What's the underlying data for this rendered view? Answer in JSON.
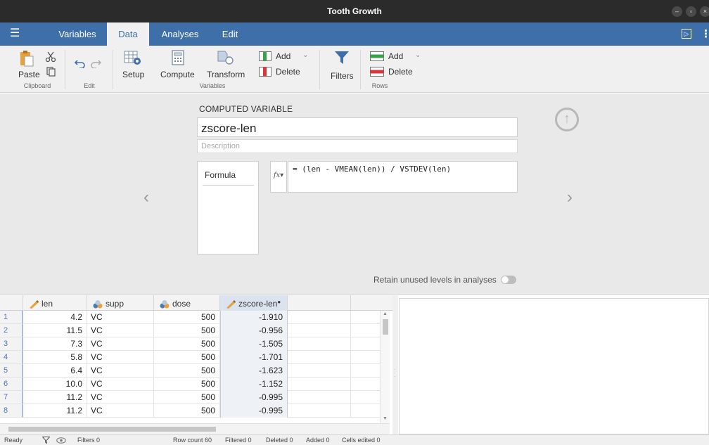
{
  "window": {
    "title": "Tooth Growth"
  },
  "menubar": {
    "tabs": [
      {
        "label": "Variables",
        "active": false
      },
      {
        "label": "Data",
        "active": true
      },
      {
        "label": "Analyses",
        "active": false
      },
      {
        "label": "Edit",
        "active": false
      }
    ]
  },
  "ribbon": {
    "clipboard": {
      "paste_label": "Paste",
      "group_label": "Clipboard"
    },
    "edit": {
      "group_label": "Edit"
    },
    "variables": {
      "setup_label": "Setup",
      "compute_label": "Compute",
      "transform_label": "Transform",
      "add_label": "Add",
      "delete_label": "Delete",
      "group_label": "Variables"
    },
    "filters_label": "Filters",
    "rows": {
      "add_label": "Add",
      "delete_label": "Delete",
      "group_label": "Rows"
    }
  },
  "computed": {
    "heading": "COMPUTED VARIABLE",
    "name": "zscore-len",
    "description_placeholder": "Description",
    "formula_tab": "Formula",
    "fx_label": "fx",
    "formula": "= (len - VMEAN(len)) / VSTDEV(len)",
    "retain_label": "Retain unused levels in analyses",
    "retain_on": false
  },
  "grid": {
    "columns": [
      {
        "name": "len",
        "type": "continuous"
      },
      {
        "name": "supp",
        "type": "nominal"
      },
      {
        "name": "dose",
        "type": "nominal"
      },
      {
        "name": "zscore-len",
        "type": "computed"
      }
    ],
    "rows": [
      {
        "num": "1",
        "len": "4.2",
        "supp": "VC",
        "dose": "500",
        "z": "-1.910"
      },
      {
        "num": "2",
        "len": "11.5",
        "supp": "VC",
        "dose": "500",
        "z": "-0.956"
      },
      {
        "num": "3",
        "len": "7.3",
        "supp": "VC",
        "dose": "500",
        "z": "-1.505"
      },
      {
        "num": "4",
        "len": "5.8",
        "supp": "VC",
        "dose": "500",
        "z": "-1.701"
      },
      {
        "num": "5",
        "len": "6.4",
        "supp": "VC",
        "dose": "500",
        "z": "-1.623"
      },
      {
        "num": "6",
        "len": "10.0",
        "supp": "VC",
        "dose": "500",
        "z": "-1.152"
      },
      {
        "num": "7",
        "len": "11.2",
        "supp": "VC",
        "dose": "500",
        "z": "-0.995"
      },
      {
        "num": "8",
        "len": "11.2",
        "supp": "VC",
        "dose": "500",
        "z": "-0.995"
      }
    ]
  },
  "status": {
    "ready": "Ready",
    "filters": "Filters 0",
    "row_count": "Row count 60",
    "filtered": "Filtered 0",
    "deleted": "Deleted 0",
    "added": "Added 0",
    "cells_edited": "Cells edited 0"
  },
  "colors": {
    "accent": "#3e6fa8",
    "titlebar": "#2b2b2b",
    "panel": "#e9e9e9"
  }
}
